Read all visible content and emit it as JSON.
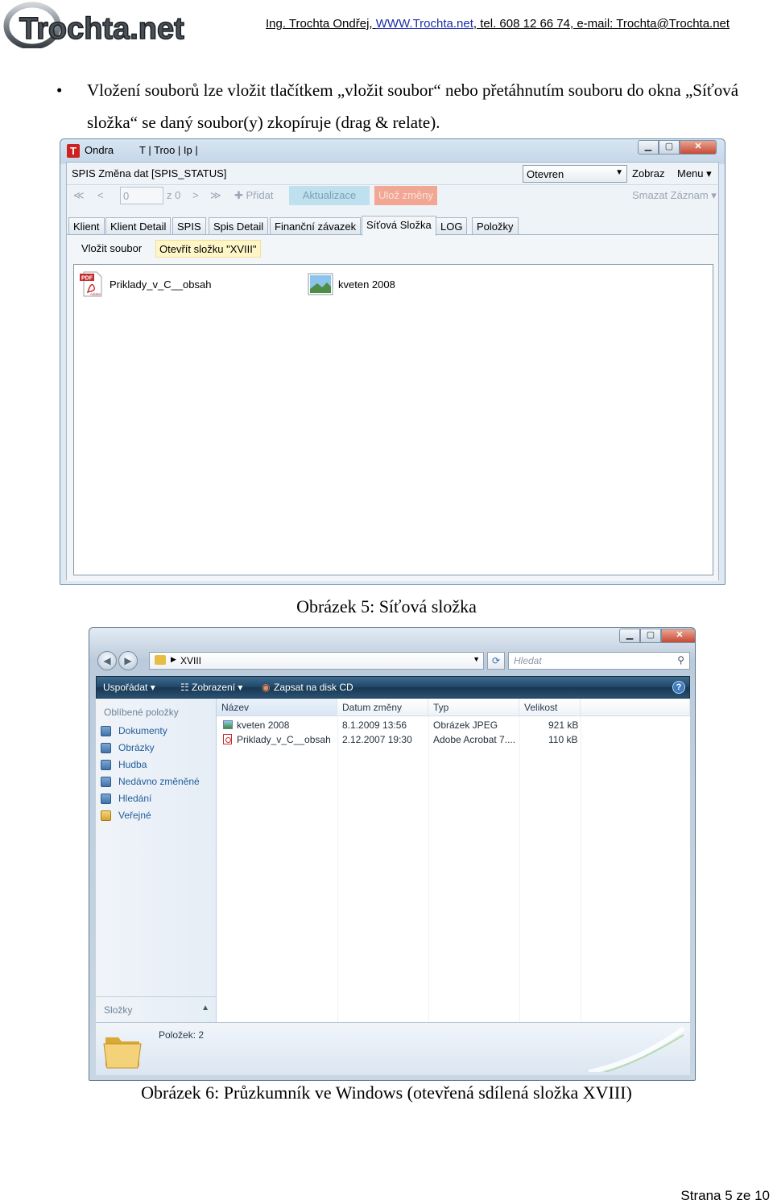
{
  "header": {
    "logo_text": "Trochta.net",
    "info_prefix": "Ing. Trochta Ondřej, ",
    "info_link": "WWW.Trochta.net",
    "info_suffix": ", tel. 608 12 66 74, e-mail: Trochta@Trochta.net"
  },
  "bullet": {
    "dot": "•",
    "text": "Vložení souborů lze vložit tlačítkem „vložit soubor“ nebo přetáhnutím souboru do okna „Síťová složka“  se daný soubor(y) zkopíruje (drag & relate)."
  },
  "figure1": {
    "caption": "Obrázek 5: Síťová složka",
    "title_user": "Ondra",
    "title_rest": "T | Troo | Ip |",
    "form_title": "SPIS Změna dat [SPIS_STATUS]",
    "status_value": "Otevren",
    "zobraz_label": "Zobraz",
    "menu_label": "Menu ▾",
    "nav_first": "≪",
    "nav_prev": "<",
    "record_value": "0",
    "record_of": "z 0",
    "nav_next": ">",
    "nav_last": "≫",
    "add_label": "✚ Přidat",
    "refresh_label": "Aktualizace",
    "save_label": "Ulož změny",
    "delete_label": "Smazat Záznam ▾",
    "tabs": [
      "Klient",
      "Klient Detail",
      "SPIS",
      "Spis Detail",
      "Finanční závazek",
      "Síťová Složka",
      "LOG",
      "Položky"
    ],
    "insert_file_label": "Vložit soubor",
    "open_folder_label": "Otevřít složku \"XVIII\"",
    "files": [
      "Priklady_v_C__obsah",
      "kveten 2008"
    ],
    "pdf_badge": "PDF",
    "pdf_brand": "Adobe"
  },
  "figure2": {
    "caption": "Obrázek 6: Průzkumník ve Windows  (otevřená sdílená složka XVIII)",
    "address": "XVIII",
    "search_placeholder": "Hledat",
    "cmd_organize": "Uspořádat ▾",
    "cmd_views": "Zobrazení ▾",
    "cmd_burn": "Zapsat na disk CD",
    "favorites_header": "Oblíbené položky",
    "favorites": [
      "Dokumenty",
      "Obrázky",
      "Hudba",
      "Nedávno změněné",
      "Hledání",
      "Veřejné"
    ],
    "folders_label": "Složky",
    "columns": [
      "Název",
      "Datum změny",
      "Typ",
      "Velikost"
    ],
    "rows": [
      {
        "name": "kveten 2008",
        "date": "8.1.2009 13:56",
        "type": "Obrázek JPEG",
        "size": "921 kB"
      },
      {
        "name": "Priklady_v_C__obsah",
        "date": "2.12.2007 19:30",
        "type": "Adobe Acrobat 7....",
        "size": "110 kB"
      }
    ],
    "item_count": "Položek: 2"
  },
  "footer": {
    "page": "Strana 5 ze 10"
  },
  "colors": {
    "link": "#1a2ea8",
    "save_button": "#f2a794",
    "refresh_button": "#bfe0ef",
    "explorer_bar": "#1f4666"
  }
}
